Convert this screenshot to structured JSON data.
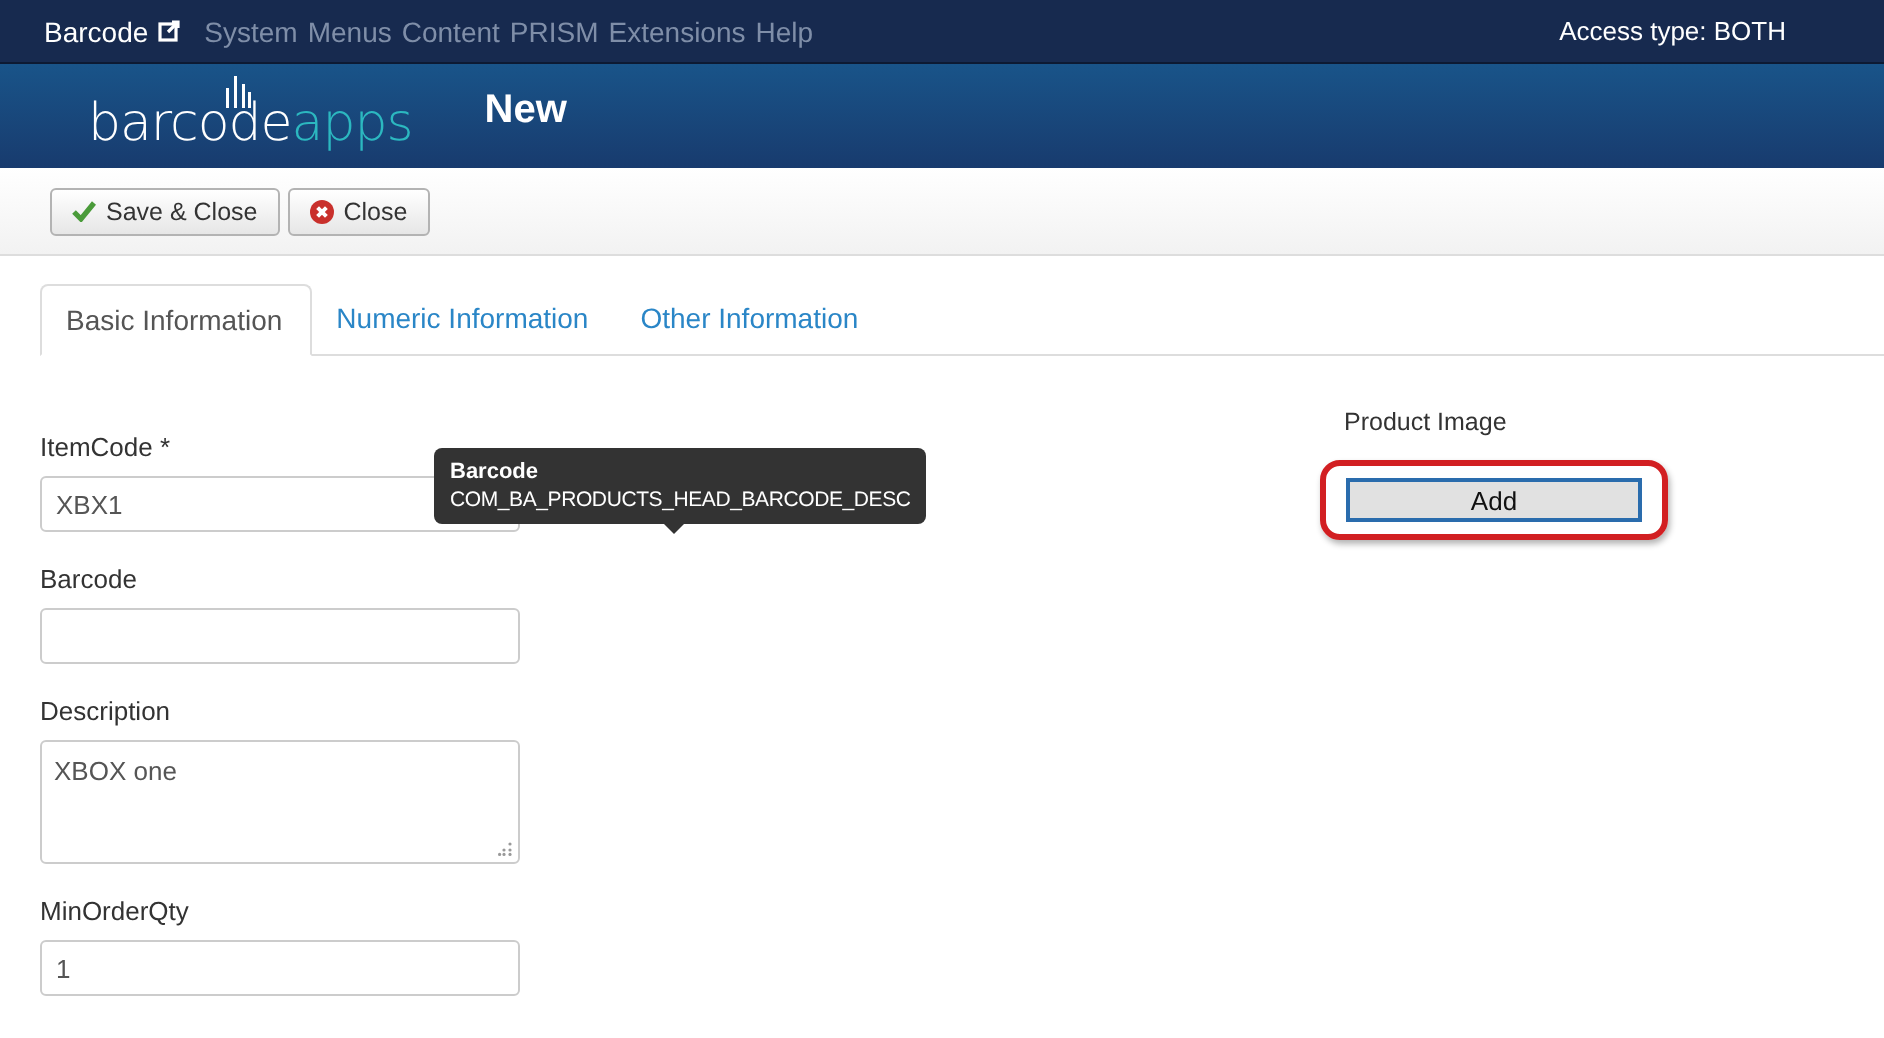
{
  "top_bar": {
    "brand": "Barcode",
    "menu": [
      "System",
      "Menus",
      "Content",
      "PRISM",
      "Extensions",
      "Help"
    ],
    "access": "Access type: BOTH"
  },
  "header": {
    "logo": {
      "word": "barcode",
      "accent": "apps"
    },
    "title": "New"
  },
  "toolbar": [
    {
      "kind": "save",
      "label": "Save & Close"
    },
    {
      "kind": "close",
      "label": "Close"
    }
  ],
  "tabs": [
    {
      "label": "Basic Information",
      "selected": true
    },
    {
      "label": "Numeric Information",
      "selected": false
    },
    {
      "label": "Other Information",
      "selected": false
    }
  ],
  "fields": [
    {
      "label": "ItemCode *",
      "kind": "input",
      "value": "XBX1"
    },
    {
      "label": "Barcode",
      "kind": "input"
    },
    {
      "label": "Description",
      "kind": "textarea",
      "value": "XBOX one"
    },
    {
      "label": "MinOrderQty",
      "kind": "input",
      "value": "1"
    }
  ],
  "tooltip": {
    "title": "Barcode",
    "text": "COM_BA_PRODUCTS_HEAD_BARCODE_DESC"
  },
  "product_image": {
    "label": "Product Image",
    "button": "Add",
    "highlighted": true
  }
}
